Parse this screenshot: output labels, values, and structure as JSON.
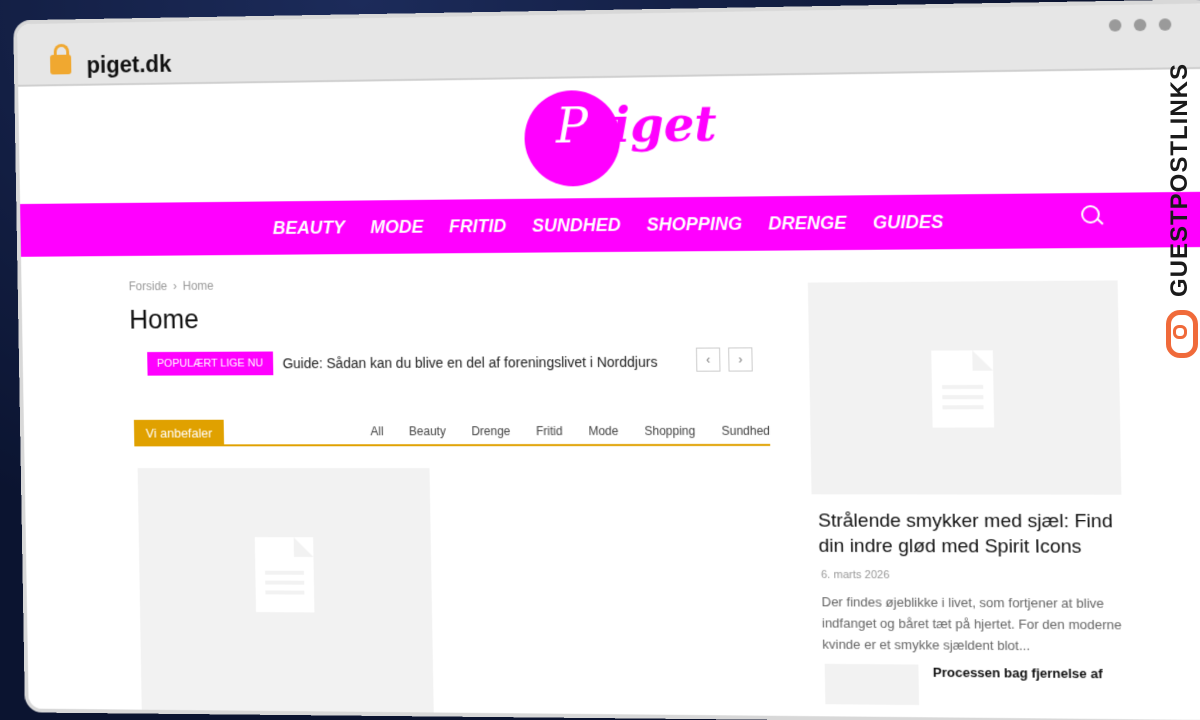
{
  "browser": {
    "url": "piget.dk"
  },
  "logo": {
    "initial": "P",
    "rest": "iget"
  },
  "nav": {
    "items": [
      {
        "label": "BEAUTY"
      },
      {
        "label": "MODE"
      },
      {
        "label": "FRITID"
      },
      {
        "label": "SUNDHED"
      },
      {
        "label": "SHOPPING"
      },
      {
        "label": "DRENGE"
      },
      {
        "label": "GUIDES"
      }
    ]
  },
  "breadcrumb": {
    "home": "Forside",
    "separator": "›",
    "current": "Home"
  },
  "page": {
    "title": "Home"
  },
  "trending": {
    "badge": "POPULÆRT LIGE NU",
    "text": "Guide: Sådan kan du blive en del af foreningslivet i Norddjurs",
    "prev": "‹",
    "next": "›"
  },
  "recommend": {
    "label": "Vi anbefaler",
    "tabs": [
      "All",
      "Beauty",
      "Drenge",
      "Fritid",
      "Mode",
      "Shopping",
      "Sundhed"
    ]
  },
  "sidebar": {
    "featured_title": "Strålende smykker med sjæl: Find din indre glød med Spirit Icons",
    "featured_date": "6. marts 2026",
    "featured_excerpt": "Der findes øjeblikke i livet, som fortjener at blive indfanget og båret tæt på hjertet. For den moderne kvinde er et smykke sjældent blot...",
    "next_title": "Processen bag fjernelse af"
  },
  "badge": {
    "text": "GUESTPOSTLINKS"
  },
  "colors": {
    "brand": "#ff00ff",
    "accent": "#e0a100"
  }
}
